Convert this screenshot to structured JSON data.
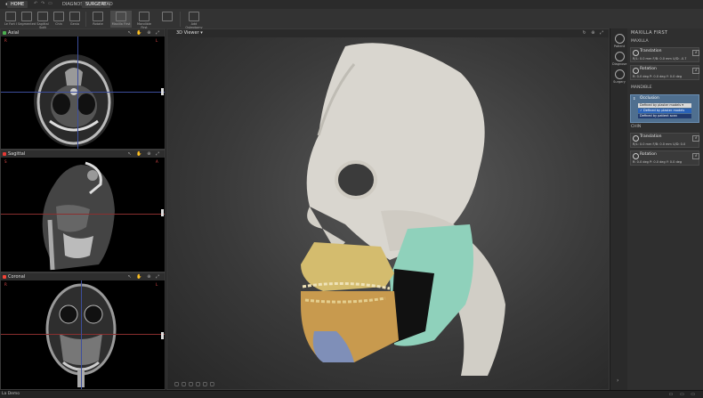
{
  "tabs": [
    "HOME",
    "DIAGNOSE",
    "SURGERY",
    "CAD"
  ],
  "ribbon_buttons": [
    "Le Fort I",
    "Segmented",
    "Sagittal Split",
    "Chin",
    "Genio",
    "Rotate",
    "Maxilla First",
    "Mandible First",
    "Add Osteotomy"
  ],
  "panels": [
    {
      "label": "Axial",
      "color": "#4caf50"
    },
    {
      "label": "Sagittal",
      "color": "#e53935"
    },
    {
      "label": "Coronal",
      "color": "#f44336"
    }
  ],
  "viewer": {
    "label": "3D Viewer"
  },
  "strip": [
    "Patient",
    "Diagnose",
    "Surgery"
  ],
  "right_panel": {
    "title": "MAXILLA FIRST",
    "sections": [
      "MAXILLA",
      "MANDIBLE",
      "CHIN"
    ],
    "maxilla_translation": {
      "title": "Translation",
      "values": "R/L: 0.0 mm  F/B: 0.0 mm  U/D: -0.7"
    },
    "maxilla_rotation": {
      "title": "Rotation",
      "values": "R: 0.0 deg  P: 0.0 deg  Y: 0.0 deg"
    },
    "occlusion": {
      "title": "Occlusion",
      "selected": "Defined by plaster models",
      "options": [
        "Defined by plaster models",
        "Defined by patient scan"
      ]
    },
    "chin_translation": {
      "title": "Translation",
      "values": "R/L: 0.0 mm  F/B: 0.0 mm  U/D: 0.0"
    },
    "chin_rotation": {
      "title": "Rotation",
      "values": "R: 0.0 deg  P: 0.0 deg  Y: 0.0 deg"
    }
  },
  "status": {
    "user": "La Demo"
  },
  "colors": {
    "maxilla": "#d4bc6e",
    "mandible": "#c89a4e",
    "ramus": "#8fd1bb",
    "chin": "#7f8fb8",
    "bone": "#d9d6cf"
  }
}
